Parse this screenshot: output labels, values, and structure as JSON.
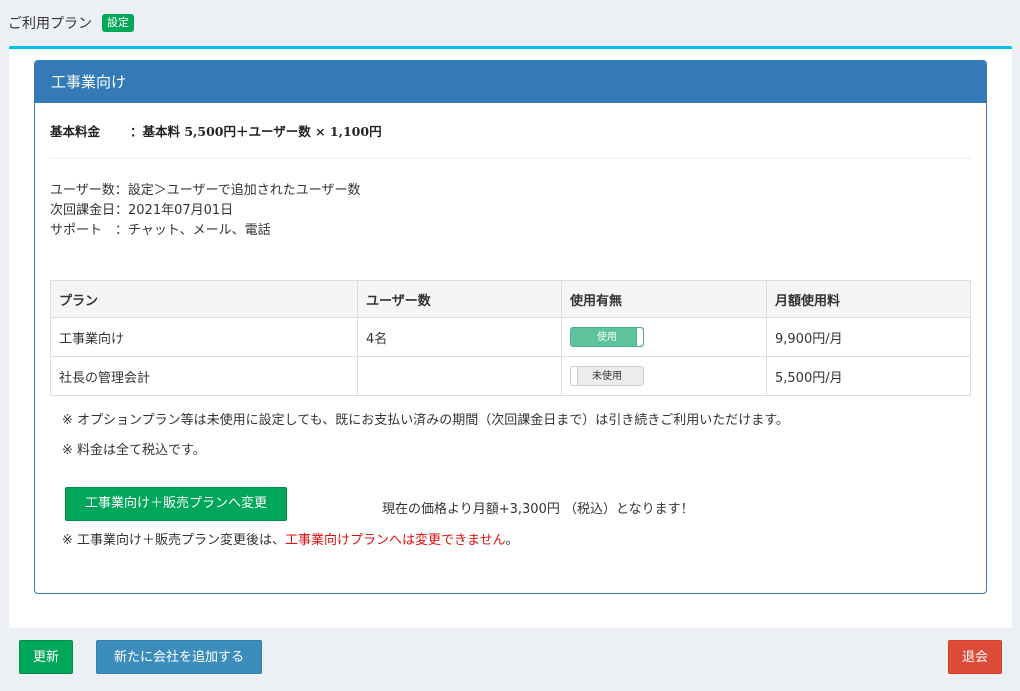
{
  "header": {
    "title": "ご利用プラン",
    "badge": "設定"
  },
  "panel": {
    "heading": "工事業向け",
    "fee_label": "基本料金",
    "fee_value": "：基本料 5,500円＋ユーザー数 × 1,100円",
    "info": [
      {
        "key": "ユーザー数：",
        "value": "設定＞ユーザーで追加されたユーザー数"
      },
      {
        "key": "次回課金日：",
        "value": "2021年07月01日"
      },
      {
        "key": "サポート　：",
        "value": "チャット、メール、電話"
      }
    ]
  },
  "table": {
    "headers": [
      "プラン",
      "ユーザー数",
      "使用有無",
      "月額使用料"
    ],
    "rows": [
      {
        "plan": "工事業向け",
        "users": "4名",
        "toggle": "使用",
        "toggle_state": "on",
        "fee": "9,900円/月"
      },
      {
        "plan": "社長の管理会計",
        "users": "",
        "toggle": "未使用",
        "toggle_state": "off",
        "fee": "5,500円/月"
      }
    ]
  },
  "notes": {
    "note1": "※ オプションプラン等は未使用に設定しても、既にお支払い済みの期間（次回課金日まで）は引き続きご利用いただけます。",
    "note2": "※ 料金は全て税込です。",
    "change_button": "工事業向け＋販売プランへ変更",
    "price_message": "現在の価格より月額+3,300円 （税込）となります！",
    "warning_prefix": "※ 工事業向け＋販売プラン変更後は、",
    "warning_red": "工事業向けプランへは変更できません",
    "warning_suffix": "。"
  },
  "footer": {
    "update": "更新",
    "add_company": "新たに会社を追加する",
    "leave": "退会"
  },
  "colors": {
    "accent_top": "#00c0ef",
    "panel": "#337ab7",
    "green": "#00a65a",
    "blue": "#3c8dbc",
    "red": "#dd4b39"
  }
}
